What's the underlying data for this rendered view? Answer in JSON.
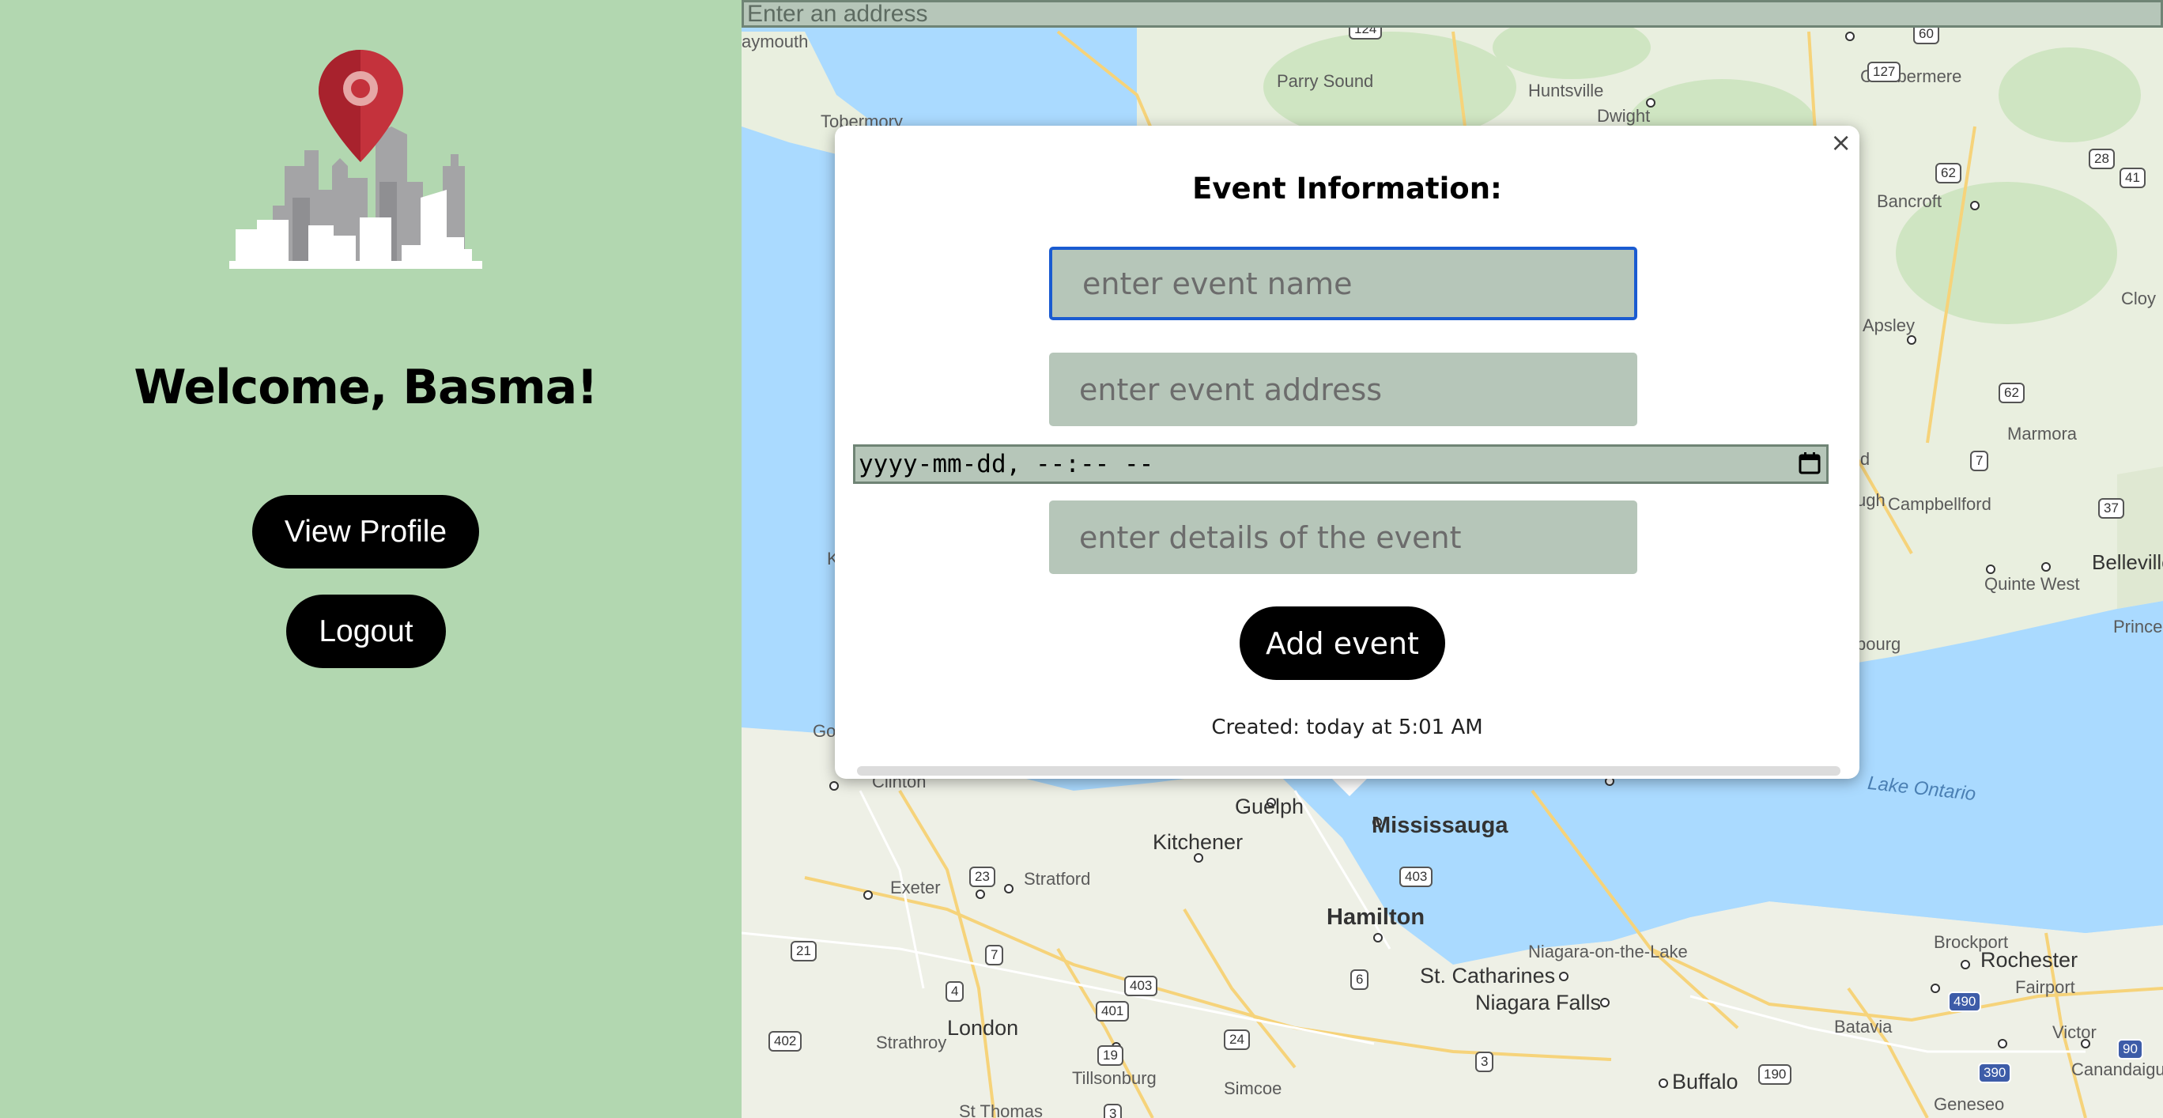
{
  "sidebar": {
    "welcome": "Welcome, Basma!",
    "view_profile_label": "View Profile",
    "logout_label": "Logout",
    "logo_icon": "city-skyline-pin-icon"
  },
  "map": {
    "address_placeholder": "Enter an address",
    "labels": {
      "parry_sound": "Parry Sound",
      "huntsville": "Huntsville",
      "dwight": "Dwight",
      "combermere": "Combermere",
      "bancroft": "Bancroft",
      "apsley": "Apsley",
      "marmora": "Marmora",
      "campbellford": "Campbellford",
      "belleville": "Belleville",
      "quinte_west": "Quinte West",
      "prince_edw": "Prince Edw",
      "tobermory": "Tobermory",
      "aymouth": "aymouth",
      "clinton": "Clinton",
      "guelph": "Guelph",
      "kitchener": "Kitchener",
      "mississauga": "Mississauga",
      "hamilton": "Hamilton",
      "exeter": "Exeter",
      "stratford": "Stratford",
      "london": "London",
      "strathroy": "Strathroy",
      "tillsonburg": "Tillsonburg",
      "simcoe": "Simcoe",
      "st_thomas": "St Thomas",
      "niagara_on_the_lake": "Niagara-on-the-Lake",
      "st_catharines": "St. Catharines",
      "niagara_falls": "Niagara Falls",
      "buffalo": "Buffalo",
      "brockport": "Brockport",
      "rochester": "Rochester",
      "fairport": "Fairport",
      "batavia": "Batavia",
      "victor": "Victor",
      "canandaigua": "Canandaigu",
      "geneseo": "Geneseo",
      "lake_ontario": "Lake Ontario",
      "ugh": "ugh",
      "ld": "ld",
      "ourg": "bourg",
      "go": "Go",
      "cloy": "Cloy",
      "k": "K"
    },
    "shields": {
      "r124": "124",
      "r60": "60",
      "r127": "127",
      "r62a": "62",
      "r28": "28",
      "r41": "41",
      "r62b": "62",
      "r7a": "7",
      "r37": "37",
      "r23": "23",
      "r21": "21",
      "r7b": "7",
      "r4": "4",
      "r403a": "403",
      "r403b": "403",
      "r401": "401",
      "r6": "6",
      "r402": "402",
      "r19": "19",
      "r24": "24",
      "r3a": "3",
      "r3b": "3",
      "r190": "190",
      "r490": "490",
      "r90": "90",
      "r390": "390"
    }
  },
  "modal": {
    "title": "Event Information:",
    "name_placeholder": "enter event name",
    "address_placeholder": "enter event address",
    "datetime_placeholder": "yyyy-mm-dd, --:-- --",
    "details_placeholder": "enter details of the event",
    "add_label": "Add event",
    "created_text": "Created: today at 5:01 AM",
    "close_symbol": "×"
  },
  "colors": {
    "sidebar_bg": "#b2d7b0",
    "input_bg": "#b6c6b9",
    "focus_border": "#1a5bd1",
    "button_bg": "#000000",
    "water": "#aadaff",
    "land": "#eef0e6"
  }
}
